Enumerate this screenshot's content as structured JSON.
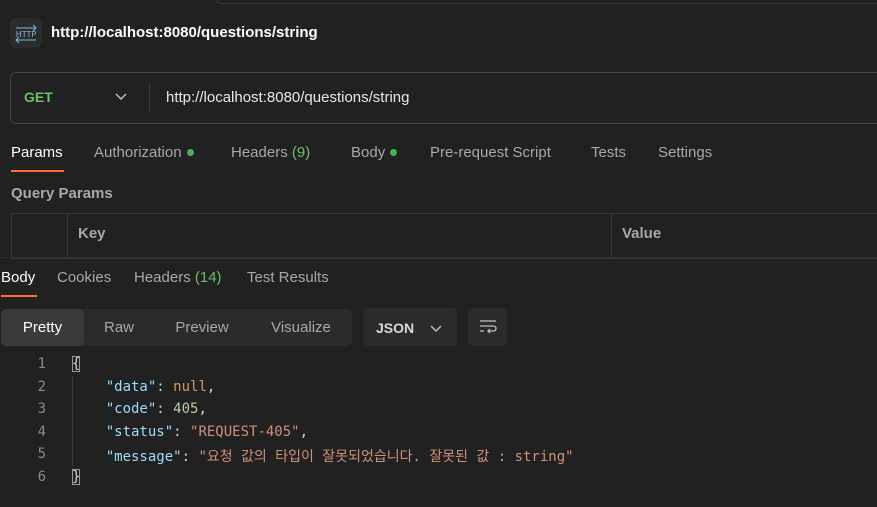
{
  "header": {
    "title_url": "http://localhost:8080/questions/string",
    "badge_icon": "http-icon"
  },
  "request": {
    "method": "GET",
    "url": "http://localhost:8080/questions/string"
  },
  "request_tabs": {
    "params": "Params",
    "authorization": "Authorization",
    "headers": "Headers",
    "headers_count": "(9)",
    "body": "Body",
    "prerequest": "Pre-request Script",
    "tests": "Tests",
    "settings": "Settings"
  },
  "query_params": {
    "label": "Query Params",
    "columns": [
      "Key",
      "Value"
    ]
  },
  "response_tabs": {
    "body": "Body",
    "cookies": "Cookies",
    "headers": "Headers",
    "headers_count": "(14)",
    "test_results": "Test Results"
  },
  "view_modes": [
    "Pretty",
    "Raw",
    "Preview",
    "Visualize"
  ],
  "format_select": "JSON",
  "code": {
    "line_numbers": [
      "1",
      "2",
      "3",
      "4",
      "5",
      "6"
    ],
    "open_brace": "{",
    "close_brace": "}",
    "key_data": "\"data\"",
    "val_data": "null",
    "key_code": "\"code\"",
    "val_code": "405",
    "key_status": "\"status\"",
    "val_status": "\"REQUEST-405\"",
    "key_message": "\"message\"",
    "val_message": "\"요청 값의 타입이 잘못되었습니다. 잘못된 값 : string\""
  },
  "colors": {
    "accent": "#ff6c37",
    "method_get": "#6bbf6b",
    "status_dot": "#4caf50",
    "json_key": "#9cdcfe",
    "json_string": "#ce9178",
    "json_number": "#b5cea8"
  }
}
